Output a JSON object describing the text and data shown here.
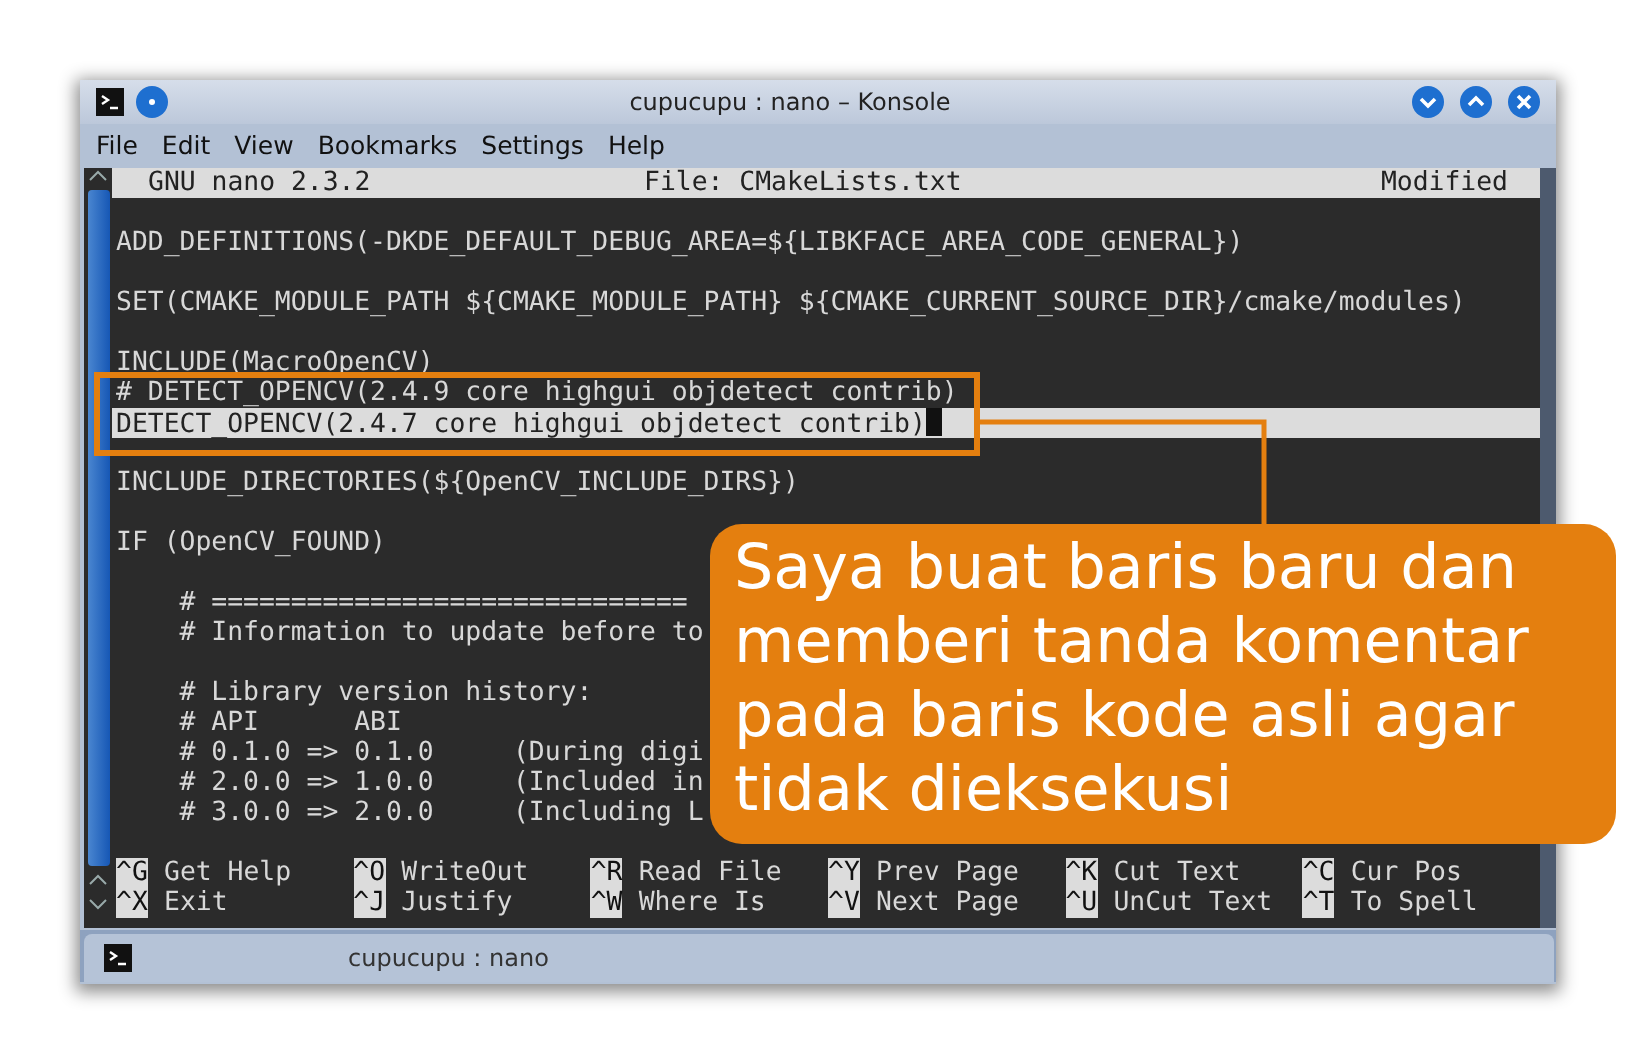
{
  "window": {
    "title": "cupucupu : nano – Konsole"
  },
  "menu": [
    "File",
    "Edit",
    "View",
    "Bookmarks",
    "Settings",
    "Help"
  ],
  "nano": {
    "version": "GNU nano 2.3.2",
    "file": "File: CMakeLists.txt",
    "status": "Modified"
  },
  "lines": [
    {
      "kind": "blank"
    },
    {
      "kind": "code",
      "text": "ADD_DEFINITIONS(-DKDE_DEFAULT_DEBUG_AREA=${LIBKFACE_AREA_CODE_GENERAL})",
      "selected": false,
      "cursor": false
    },
    {
      "kind": "blank"
    },
    {
      "kind": "code",
      "text": "SET(CMAKE_MODULE_PATH ${CMAKE_MODULE_PATH} ${CMAKE_CURRENT_SOURCE_DIR}/cmake/modules)",
      "selected": false,
      "cursor": false
    },
    {
      "kind": "blank"
    },
    {
      "kind": "code",
      "text": "INCLUDE(MacroOpenCV)",
      "selected": false,
      "cursor": false
    },
    {
      "kind": "code",
      "text": "# DETECT_OPENCV(2.4.9 core highgui objdetect contrib)",
      "selected": false,
      "cursor": false
    },
    {
      "kind": "code",
      "text": "DETECT_OPENCV(2.4.7 core highgui objdetect contrib)",
      "selected": true,
      "cursor": true
    },
    {
      "kind": "blank"
    },
    {
      "kind": "code",
      "text": "INCLUDE_DIRECTORIES(${OpenCV_INCLUDE_DIRS})",
      "selected": false,
      "cursor": false
    },
    {
      "kind": "blank"
    },
    {
      "kind": "code",
      "text": "IF (OpenCV_FOUND)",
      "selected": false,
      "cursor": false
    },
    {
      "kind": "blank"
    },
    {
      "kind": "code",
      "text": "    # ==============================",
      "selected": false,
      "cursor": false
    },
    {
      "kind": "code",
      "text": "    # Information to update before to",
      "selected": false,
      "cursor": false
    },
    {
      "kind": "blank"
    },
    {
      "kind": "code",
      "text": "    # Library version history:",
      "selected": false,
      "cursor": false
    },
    {
      "kind": "code",
      "text": "    # API      ABI",
      "selected": false,
      "cursor": false
    },
    {
      "kind": "code",
      "text": "    # 0.1.0 => 0.1.0     (During digi",
      "selected": false,
      "cursor": false
    },
    {
      "kind": "code",
      "text": "    # 2.0.0 => 1.0.0     (Included in",
      "selected": false,
      "cursor": false
    },
    {
      "kind": "code",
      "text": "    # 3.0.0 => 2.0.0     (Including L",
      "selected": false,
      "cursor": false
    },
    {
      "kind": "blank"
    }
  ],
  "shortcut_rows": [
    [
      {
        "key": "^G",
        "label": "Get Help"
      },
      {
        "key": "^O",
        "label": "WriteOut"
      },
      {
        "key": "^R",
        "label": "Read File"
      },
      {
        "key": "^Y",
        "label": "Prev Page"
      },
      {
        "key": "^K",
        "label": "Cut Text"
      },
      {
        "key": "^C",
        "label": "Cur Pos"
      }
    ],
    [
      {
        "key": "^X",
        "label": "Exit"
      },
      {
        "key": "^J",
        "label": "Justify"
      },
      {
        "key": "^W",
        "label": "Where Is"
      },
      {
        "key": "^V",
        "label": "Next Page"
      },
      {
        "key": "^U",
        "label": "UnCut Text"
      },
      {
        "key": "^T",
        "label": "To Spell"
      }
    ]
  ],
  "tabs": [
    {
      "label": "cupucupu : nano",
      "selected": true
    }
  ],
  "callout": {
    "text": "Saya buat baris baru dan memberi tanda komentar pada baris kode asli agar tidak dieksekusi"
  }
}
